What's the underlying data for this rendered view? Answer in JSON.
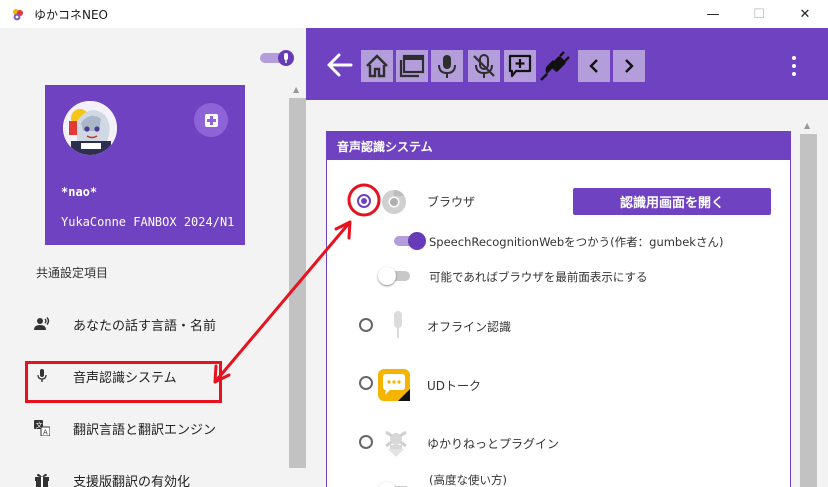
{
  "window": {
    "title": "ゆかコネNEO",
    "controls": {
      "minimize": "—",
      "maximize": "☐",
      "close": "✕"
    }
  },
  "sidebar": {
    "profile": {
      "name": "*nao*",
      "subtitle": "YukaConne FANBOX 2024/N1",
      "add_icon": "add-profile-icon"
    },
    "section_label": "共通設定項目",
    "items": [
      {
        "label": "あなたの話す言語・名前",
        "icon": "voice-person-icon"
      },
      {
        "label": "音声認識システム",
        "icon": "microphone-icon"
      },
      {
        "label": "翻訳言語と翻訳エンジン",
        "icon": "translate-icon"
      },
      {
        "label": "支援版翻訳の有効化",
        "icon": "gift-icon"
      }
    ]
  },
  "toolbar": {
    "buttons": [
      "back-arrow-icon",
      "home-icon",
      "window-icon",
      "microphone-icon",
      "microphone-off-icon",
      "add-comment-icon",
      "plug-icon",
      "chevron-left-icon",
      "chevron-right-icon",
      "more-vertical-icon"
    ]
  },
  "recognition": {
    "header": "音声認識システム",
    "open_button": "認識用画面を開く",
    "options": [
      {
        "label": "ブラウザ",
        "icon": "chrome-icon",
        "selected": true
      },
      {
        "label": "オフライン認識",
        "icon": "microphone-icon",
        "selected": false
      },
      {
        "label": "UDトーク",
        "icon": "udtalk-icon",
        "selected": false
      },
      {
        "label": "ゆかりねっとプラグイン",
        "icon": "plugin-icon",
        "selected": false
      }
    ],
    "browser_settings": [
      {
        "label": "SpeechRecognitionWebをつかう(作者：gumbekさん)",
        "enabled": true
      },
      {
        "label": "可能であればブラウザを最前面表示にする",
        "enabled": false
      }
    ],
    "advanced_label": "(高度な使い方)"
  },
  "colors": {
    "accent": "#6f42c1",
    "accent_light": "#b39ddb",
    "annotation": "#e8121e"
  }
}
